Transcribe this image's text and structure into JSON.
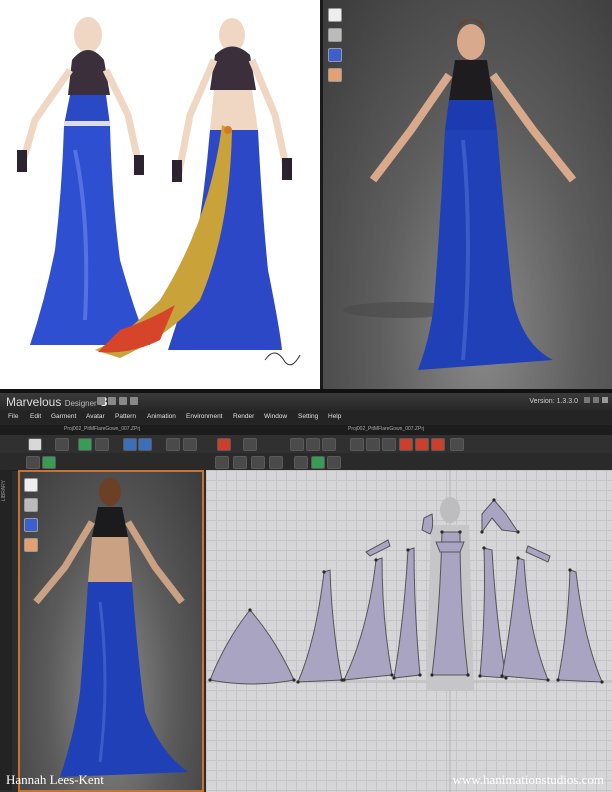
{
  "app": {
    "brand_name": "Marvelous",
    "brand_sub": "Designer",
    "brand_version_mark": "3",
    "version_label": "Version:  1.3.3.0"
  },
  "menu": {
    "items": [
      "File",
      "Edit",
      "Garment",
      "Avatar",
      "Pattern",
      "Animation",
      "Environment",
      "Render",
      "Window",
      "Setting",
      "Help"
    ]
  },
  "tabs": {
    "left": "Proj002_PitMFlareGown_007.ZPrj",
    "right": "Proj002_PitMFlareGown_007.ZPrj"
  },
  "library": {
    "label": "LIBRARY"
  },
  "credits": {
    "left": "Hannah Lees-Kent",
    "right": "www.hanimationstudios.com"
  },
  "colors": {
    "gown_blue": "#1f3fae",
    "selection_orange": "#c8722e",
    "pattern_fill": "#a9a4c2"
  },
  "icons": {
    "side_tools": [
      "shirt-icon",
      "avatar-icon",
      "hanger-icon",
      "face-icon"
    ]
  }
}
